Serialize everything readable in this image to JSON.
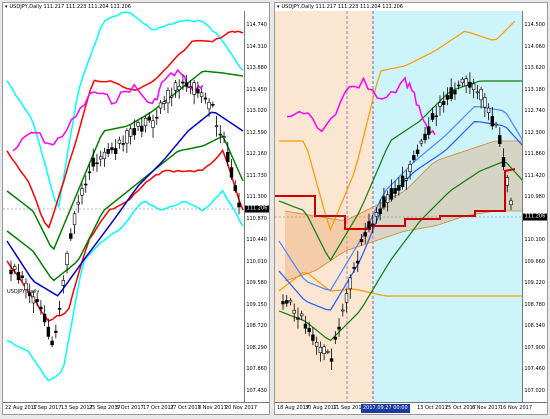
{
  "charts": [
    {
      "title": "USDJPY,Daily",
      "ohlc": "111.217 111.223 111.204 111.206",
      "sub_label": "USDJPY,Daily",
      "y_ticks": [
        "114.740",
        "114.310",
        "113.880",
        "113.450",
        "113.020",
        "112.590",
        "112.160",
        "111.730",
        "111.300",
        "110.870",
        "110.440",
        "110.010",
        "109.580",
        "109.150",
        "108.720",
        "108.290",
        "107.860",
        "107.430"
      ],
      "price_box": "111.206",
      "x_labels": [
        "22 Aug 2017",
        "1 Sep 2017",
        "13 Sep 2017",
        "25 Sep 2017",
        "5 Oct 2017",
        "17 Oct 2017",
        "27 Oct 2017",
        "8 Nov 2017",
        "20 Nov 2017"
      ]
    },
    {
      "title": "USDJPY,Daily",
      "ohlc": "111.217 111.223 111.204 111.206",
      "y_ticks": [
        "114.500",
        "114.060",
        "113.620",
        "113.180",
        "112.740",
        "112.300",
        "111.860",
        "111.420",
        "110.980",
        "110.540",
        "110.100",
        "109.660",
        "109.220",
        "108.780",
        "108.340",
        "107.900",
        "107.460",
        "107.020"
      ],
      "price_box": "111.206",
      "x_labels": [
        "18 Aug 2017",
        "30 Aug 2017",
        "11 Sep 2017",
        "13 Oct 2017",
        "25 Oct 2017",
        "6 Nov 2017",
        "16 Nov 2017"
      ],
      "selected_date": "2017.09.27 00:00"
    }
  ],
  "colors": {
    "bb_outer": "#00ffff",
    "bb_mid": "#ff0000",
    "bb_inner": "#008000",
    "ma": "#0000cd",
    "chikou": "#ff00ff",
    "kijun": "#cc0000",
    "span_band": "#ff9900",
    "kumo_bg": "#cdf3fb",
    "past_bg": "#fbe6d1"
  }
}
